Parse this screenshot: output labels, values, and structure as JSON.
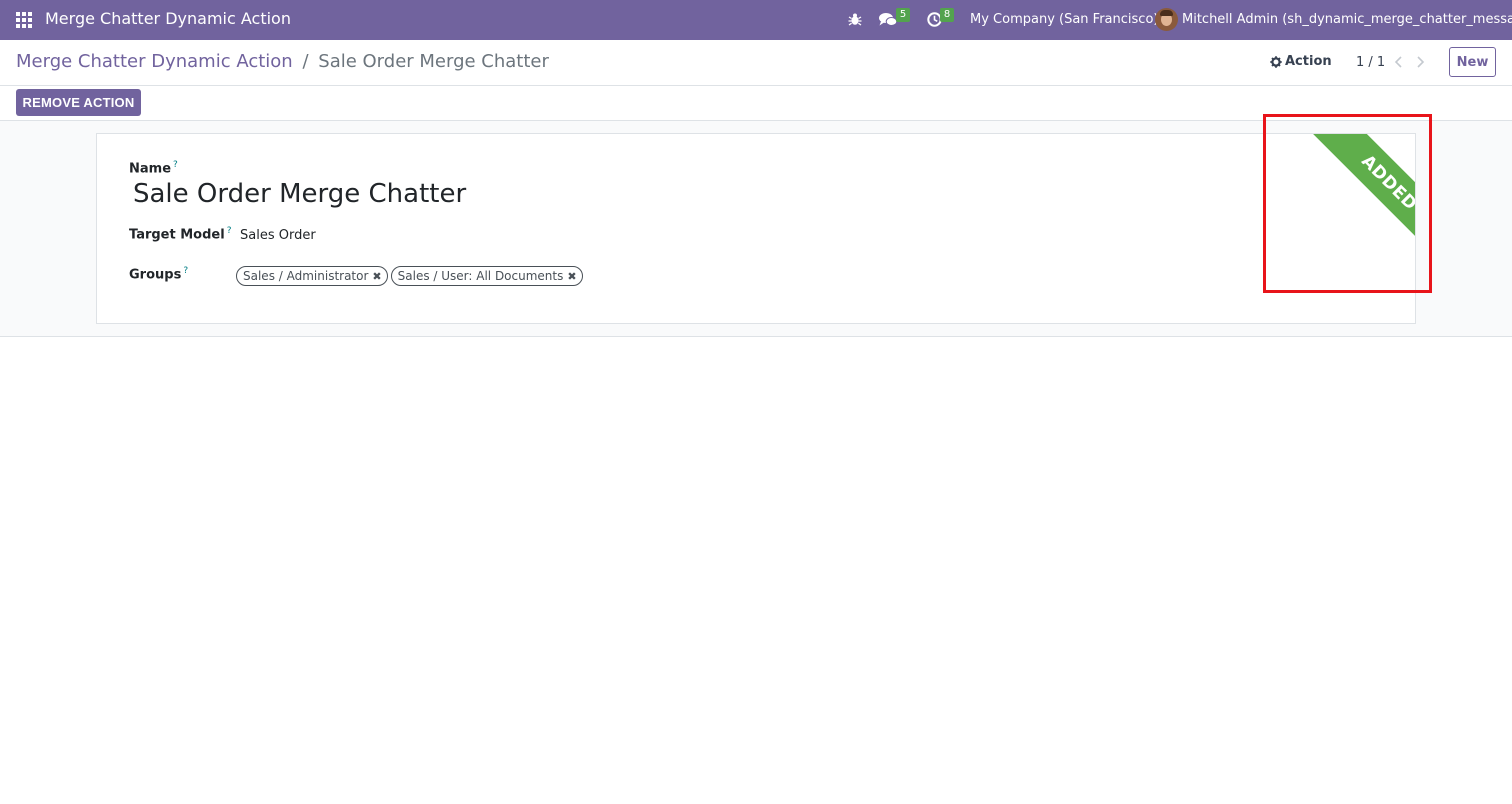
{
  "navbar": {
    "app_title": "Merge Chatter Dynamic Action",
    "messages_count": "5",
    "activities_count": "8",
    "company": "My Company (San Francisco)",
    "user": "Mitchell Admin (sh_dynamic_merge_chatter_message)",
    "color": "#71639e"
  },
  "control": {
    "breadcrumb_parent": "Merge Chatter Dynamic Action",
    "breadcrumb_separator": "/",
    "breadcrumb_current": "Sale Order Merge Chatter",
    "action_label": "Action",
    "pager": "1 / 1",
    "new_label": "New"
  },
  "statusbar": {
    "remove_action_label": "REMOVE ACTION"
  },
  "form": {
    "name_label": "Name",
    "name_help": "?",
    "name_value": "Sale Order Merge Chatter",
    "target_model_label": "Target Model",
    "target_model_help": "?",
    "target_model_value": "Sales Order",
    "groups_label": "Groups",
    "groups_help": "?",
    "groups": [
      "Sales / Administrator",
      "Sales / User: All Documents"
    ],
    "ribbon": "ADDED",
    "ribbon_color": "#5fae4b"
  }
}
